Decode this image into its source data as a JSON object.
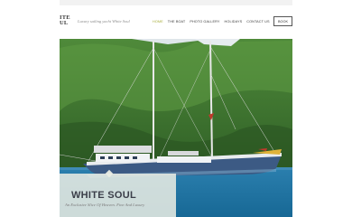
{
  "site": {
    "logo_line1": "ITE",
    "logo_line2": "UL",
    "tagline": "Luxury sailing yacht White Soul"
  },
  "nav": {
    "items": [
      "HOME",
      "THE BOAT",
      "PHOTO GALLERY",
      "HOLIDAYS",
      "CONTACT US"
    ],
    "active_index": 0,
    "book_label": "BOOK"
  },
  "hero": {
    "title": "WHITE SOUL",
    "subtitle": "An Exclusive Slice Of Heaven. Fine And Luxury"
  },
  "colors": {
    "accent": "#a7ad3a",
    "text_dark": "#3b3e49"
  }
}
